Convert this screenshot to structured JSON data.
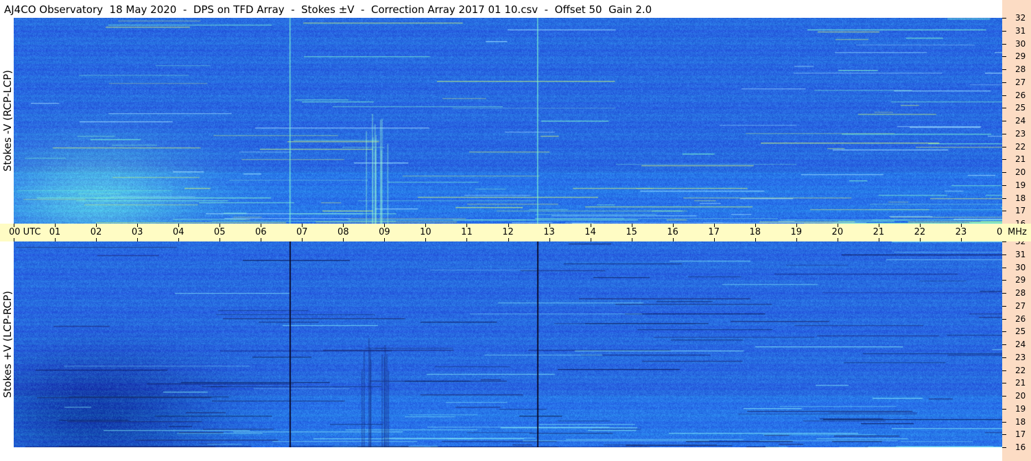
{
  "title": "AJ4CO Observatory  18 May 2020  -  DPS on TFD Array  -  Stokes ±V  -  Correction Array 2017 01 10.csv  -  Offset 50  Gain 2.0",
  "colors": {
    "panel_bg": "#2b6fe5",
    "time_axis_bg": "#fffcc4",
    "freq_axis_bg": "#fcdcc4",
    "burst_top": "#7ef5d0",
    "burst_bottom": "#0a0a2a"
  },
  "chart_data": [
    {
      "type": "heatmap",
      "ylabel": "Stokes -V (RCP-LCP)",
      "x_ticks": [
        "00  UTC",
        "01",
        "02",
        "03",
        "04",
        "05",
        "06",
        "07",
        "08",
        "09",
        "10",
        "11",
        "12",
        "13",
        "14",
        "15",
        "16",
        "17",
        "18",
        "19",
        "20",
        "21",
        "22",
        "23",
        "00"
      ],
      "x_range_hours": [
        0,
        24
      ],
      "y_ticks": [
        16,
        17,
        18,
        19,
        20,
        21,
        22,
        23,
        24,
        25,
        26,
        27,
        28,
        29,
        30,
        31,
        32
      ],
      "y_unit": "MHz",
      "ylim": [
        16,
        32
      ],
      "events_utc_hours": [
        6.7,
        12.7
      ]
    },
    {
      "type": "heatmap",
      "ylabel": "Stokes +V (LCP-RCP)",
      "x_ticks": [
        "00  UTC",
        "01",
        "02",
        "03",
        "04",
        "05",
        "06",
        "07",
        "08",
        "09",
        "10",
        "11",
        "12",
        "13",
        "14",
        "15",
        "16",
        "17",
        "18",
        "19",
        "20",
        "21",
        "22",
        "23",
        "00"
      ],
      "x_range_hours": [
        0,
        24
      ],
      "y_ticks": [
        16,
        17,
        18,
        19,
        20,
        21,
        22,
        23,
        24,
        25,
        26,
        27,
        28,
        29,
        30,
        31,
        32
      ],
      "y_unit": "MHz",
      "ylim": [
        16,
        32
      ],
      "events_utc_hours": [
        6.7,
        12.7
      ]
    }
  ]
}
